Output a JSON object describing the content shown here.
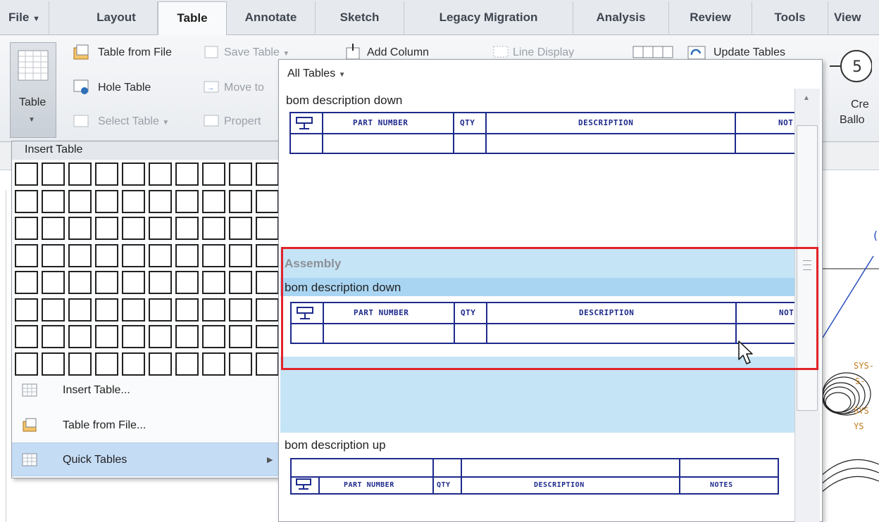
{
  "tabs": [
    "File",
    "Layout",
    "Table",
    "Annotate",
    "Sketch",
    "Legacy Migration",
    "Analysis",
    "Review",
    "Tools",
    "View"
  ],
  "ribbon": {
    "table_button": "Table",
    "table_from_file": "Table from File",
    "hole_table": "Hole Table",
    "select_table": "Select Table",
    "save_table": "Save Table",
    "move_to": "Move to",
    "properties": "Propert",
    "add_column": "Add Column",
    "line_display": "Line Display",
    "update_tables": "Update Tables",
    "create_balloons_1": "Cre",
    "create_balloons_2": "Ballo"
  },
  "insert_menu": {
    "grid_header": "Insert Table",
    "items": [
      "Insert Table...",
      "Table from File...",
      "Quick Tables"
    ]
  },
  "quick_tables": {
    "filter": "All Tables",
    "section_title": "Assembly",
    "item1_name": "bom description down",
    "item2_name": "bom description down",
    "item3_name": "bom description up",
    "headers": [
      "PART NUMBER",
      "QTY",
      "DESCRIPTION",
      "NOT"
    ],
    "headers_up": [
      "PART NUMBER",
      "QTY",
      "DESCRIPTION",
      "NOTES"
    ]
  },
  "colors": {
    "table_line": "#1e2a8c",
    "highlight": "#c5e4f6",
    "selection_box": "#e2232a"
  }
}
